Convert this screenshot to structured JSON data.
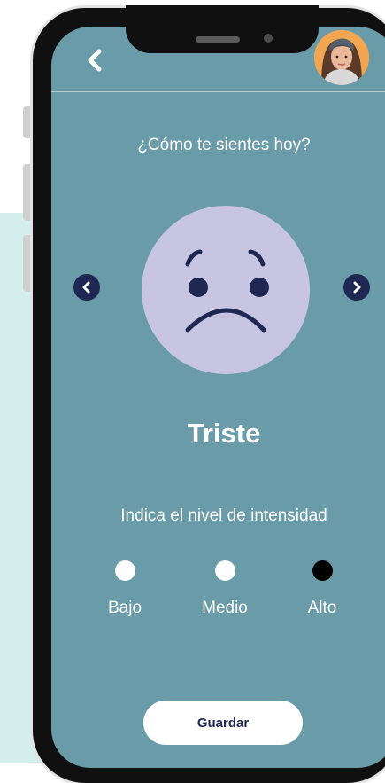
{
  "header": {
    "back_icon": "chevron-left-icon",
    "avatar_icon": "user-avatar"
  },
  "mood": {
    "question": "¿Cómo te sientes hoy?",
    "emotion": "Triste",
    "face_icon": "sad-face-icon",
    "face_color": "#c8c5e3",
    "prev_icon": "chevron-left-icon",
    "next_icon": "chevron-right-icon"
  },
  "intensity": {
    "label": "Indica el nivel de intensidad",
    "levels": [
      {
        "label": "Bajo",
        "selected": false
      },
      {
        "label": "Medio",
        "selected": false
      },
      {
        "label": "Alto",
        "selected": true
      }
    ]
  },
  "actions": {
    "save_label": "Guardar"
  },
  "colors": {
    "screen_bg": "#6a9ba8",
    "accent_dark": "#1f2753",
    "page_accent": "#d3eeec"
  }
}
